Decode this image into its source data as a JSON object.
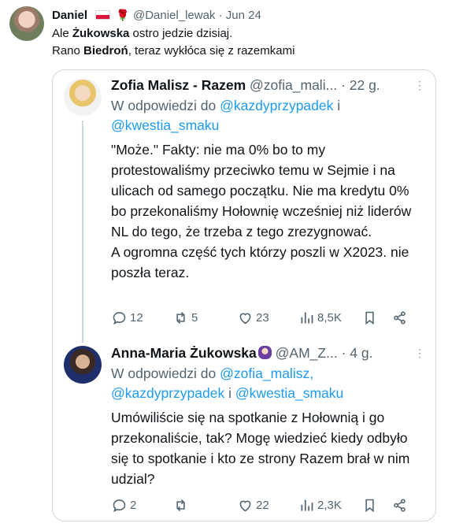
{
  "tweet": {
    "name": "Daniel",
    "handle": "@Daniel_lewak",
    "separator": "·",
    "date": "Jun 24",
    "line1_pre": "Ale ",
    "line1_bold": "Żukowska",
    "line1_post": " ostro jedzie dzisiaj.",
    "line2_pre": "Rano ",
    "line2_bold": "Biedroń",
    "line2_post": ", teraz wykłóca się z razemkami"
  },
  "quoted": [
    {
      "name": "Zofia Malisz - Razem",
      "handle": "@zofia_mali...",
      "time": "· 22 g.",
      "reply_prefix": "W odpowiedzi do",
      "reply_users": [
        "@kazdyprzypadek",
        "@kwestia_smaku"
      ],
      "reply_joiner": "i",
      "body": "\"Może.\" Fakty: nie ma 0% bo to my protestowaliśmy przeciwko temu w Sejmie i na ulicach od samego początku. Nie ma kredytu 0% bo przekonaliśmy Hołownię wcześniej niż liderów NL do tego, że trzeba z tego zrezygnować.\nA ogromna część tych którzy poszli w X2023. nie poszła teraz.",
      "replies": "12",
      "retweets": "5",
      "likes": "23",
      "views": "8,5K"
    },
    {
      "name": "Anna-Maria Żukowska",
      "handle": "@AM_Z...",
      "time": "· 4 g.",
      "reply_prefix": "W odpowiedzi do",
      "reply_users": [
        "@zofia_malisz",
        "@kazdyprzypadek",
        "@kwestia_smaku"
      ],
      "reply_joiner": "i",
      "body": "Umówiliście się na spotkanie z Hołownią i go przekonaliście, tak? Mogę wiedzieć kiedy odbyło się to spotkanie i kto ze strony Razem brał w nim udzial?",
      "replies": "2",
      "retweets": "",
      "likes": "22",
      "views": "2,3K"
    }
  ]
}
